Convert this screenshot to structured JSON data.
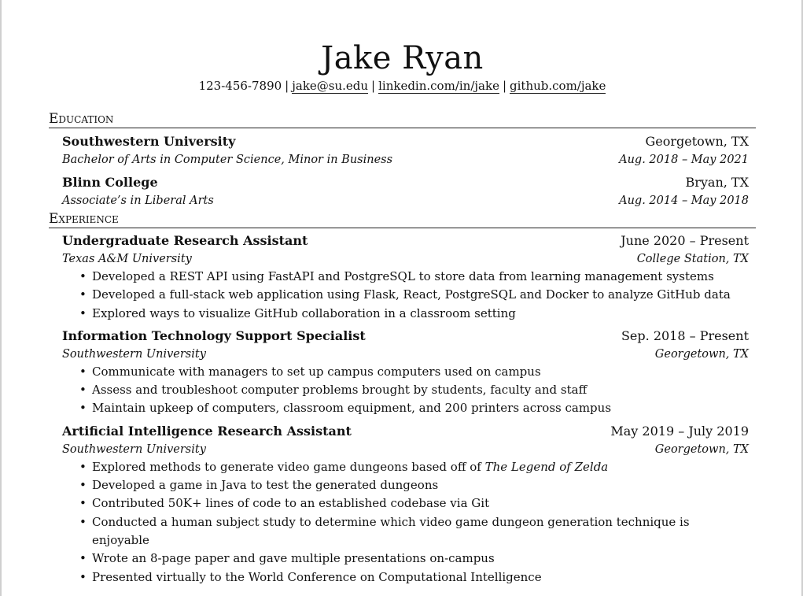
{
  "header": {
    "name": "Jake Ryan",
    "phone": "123-456-7890",
    "email": "jake@su.edu",
    "linkedin": "linkedin.com/in/jake",
    "github": "github.com/jake",
    "separator": "|"
  },
  "education": {
    "title": "Education",
    "entries": [
      {
        "school": "Southwestern University",
        "location": "Georgetown, TX",
        "degree": "Bachelor of Arts in Computer Science, Minor in Business",
        "dates": "Aug. 2018 – May 2021"
      },
      {
        "school": "Blinn College",
        "location": "Bryan, TX",
        "degree": "Associate’s in Liberal Arts",
        "dates": "Aug. 2014 – May 2018"
      }
    ]
  },
  "experience": {
    "title": "Experience",
    "entries": [
      {
        "role": "Undergraduate Research Assistant",
        "dates": "June 2020 – Present",
        "org": "Texas A&M University",
        "location": "College Station, TX",
        "bullets": [
          "Developed a REST API using FastAPI and PostgreSQL to store data from learning management systems",
          "Developed a full-stack web application using Flask, React, PostgreSQL and Docker to analyze GitHub data",
          "Explored ways to visualize GitHub collaboration in a classroom setting"
        ]
      },
      {
        "role": "Information Technology Support Specialist",
        "dates": "Sep. 2018 – Present",
        "org": "Southwestern University",
        "location": "Georgetown, TX",
        "bullets": [
          "Communicate with managers to set up campus computers used on campus",
          "Assess and troubleshoot computer problems brought by students, faculty and staff",
          "Maintain upkeep of computers, classroom equipment, and 200 printers across campus"
        ]
      },
      {
        "role": "Artificial Intelligence Research Assistant",
        "dates": "May 2019 – July 2019",
        "org": "Southwestern University",
        "location": "Georgetown, TX",
        "bullets": [
          "Explored methods to generate video game dungeons based off of ",
          "Developed a game in Java to test the generated dungeons",
          "Contributed 50K+ lines of code to an established codebase via Git",
          "Conducted a human subject study to determine which video game dungeon generation technique is enjoyable",
          "Wrote an 8-page paper and gave multiple presentations on-campus",
          "Presented virtually to the World Conference on Computational Intelligence"
        ],
        "bullet0_title": "The Legend of Zelda"
      }
    ]
  }
}
